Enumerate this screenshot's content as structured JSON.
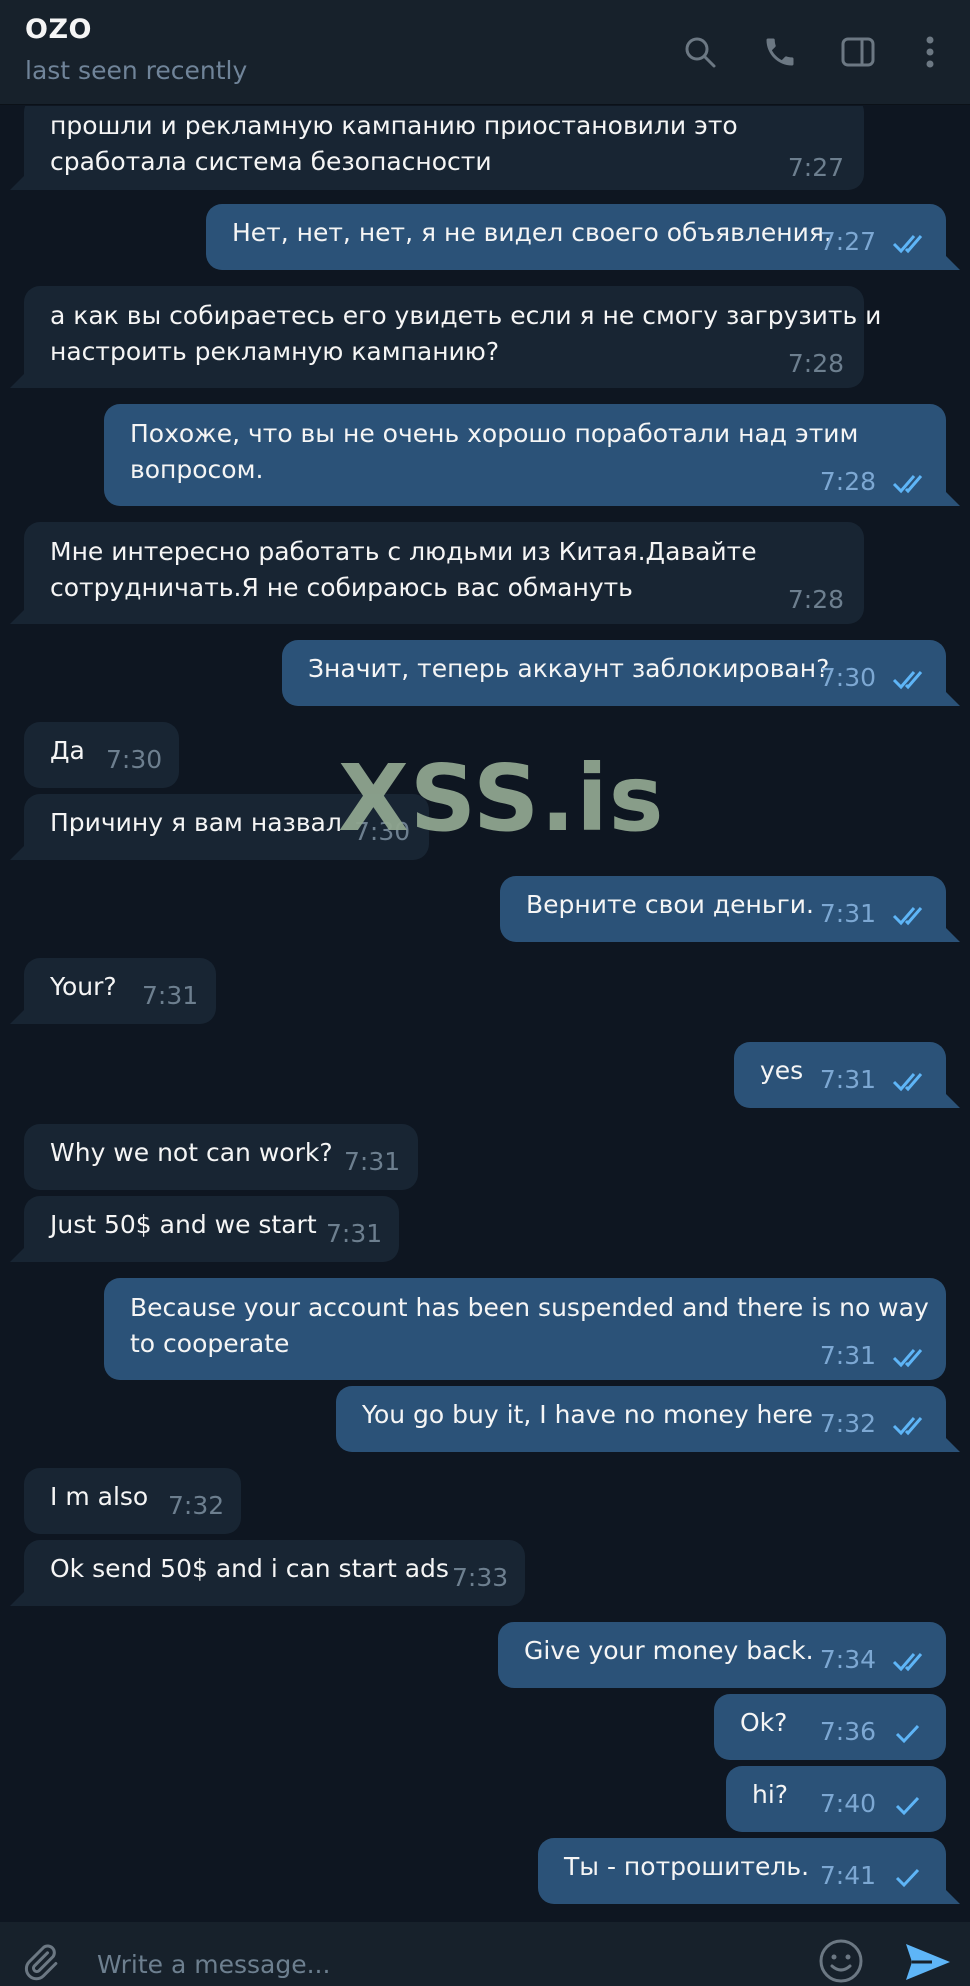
{
  "header": {
    "name": "OZO",
    "status": "last seen recently",
    "icons": [
      "search-icon",
      "phone-icon",
      "sidebar-toggle-icon",
      "more-vert-icon"
    ]
  },
  "watermark": "XSS.is",
  "messages": [
    {
      "dir": "in",
      "lines": [
        "прошли и рекламную кампанию приостановили это",
        "сработала система безопасности"
      ],
      "time": "7:27"
    },
    {
      "dir": "out",
      "lines": [
        "Нет, нет, нет, я не видел своего объявления."
      ],
      "time": "7:27",
      "status": "read"
    },
    {
      "dir": "in",
      "lines": [
        "а как вы собираетесь его увидеть если я не смогу загрузить и",
        "настроить рекламную кампанию?"
      ],
      "time": "7:28"
    },
    {
      "dir": "out",
      "lines": [
        "Похоже, что вы не очень хорошо поработали над этим",
        "вопросом."
      ],
      "time": "7:28",
      "status": "read"
    },
    {
      "dir": "in",
      "lines": [
        "Мне интересно работать с людьми из Китая.Давайте",
        "сотрудничать.Я не собираюсь вас обмануть"
      ],
      "time": "7:28"
    },
    {
      "dir": "out",
      "lines": [
        "Значит, теперь аккаунт заблокирован?"
      ],
      "time": "7:30",
      "status": "read"
    },
    {
      "dir": "in",
      "lines": [
        "Да"
      ],
      "time": "7:30"
    },
    {
      "dir": "in",
      "lines": [
        "Причину я вам назвал"
      ],
      "time": "7:30"
    },
    {
      "dir": "out",
      "lines": [
        "Верните свои деньги."
      ],
      "time": "7:31",
      "status": "read"
    },
    {
      "dir": "in",
      "lines": [
        "Your?"
      ],
      "time": "7:31"
    },
    {
      "dir": "out",
      "lines": [
        "yes"
      ],
      "time": "7:31",
      "status": "read"
    },
    {
      "dir": "in",
      "lines": [
        "Why we not can work?"
      ],
      "time": "7:31"
    },
    {
      "dir": "in",
      "lines": [
        "Just 50$ and we start"
      ],
      "time": "7:31"
    },
    {
      "dir": "out",
      "lines": [
        "Because your account has been suspended and there is no way",
        "to cooperate"
      ],
      "time": "7:31",
      "status": "read"
    },
    {
      "dir": "out",
      "lines": [
        "You go buy it, I have no money here"
      ],
      "time": "7:32",
      "status": "read"
    },
    {
      "dir": "in",
      "lines": [
        "I m also"
      ],
      "time": "7:32"
    },
    {
      "dir": "in",
      "lines": [
        "Ok send 50$ and i can start ads"
      ],
      "time": "7:33"
    },
    {
      "dir": "out",
      "lines": [
        "Give your money back."
      ],
      "time": "7:34",
      "status": "read"
    },
    {
      "dir": "out",
      "lines": [
        "Ok?"
      ],
      "time": "7:36",
      "status": "sent"
    },
    {
      "dir": "out",
      "lines": [
        "hi?"
      ],
      "time": "7:40",
      "status": "sent"
    },
    {
      "dir": "out",
      "lines": [
        "Ты - потрошитель."
      ],
      "time": "7:41",
      "status": "sent"
    }
  ],
  "composer": {
    "placeholder": "Write a message..."
  },
  "colors": {
    "background": "#0e1621",
    "header": "#17212b",
    "incoming_bubble": "#182533",
    "outgoing_bubble": "#2b5278",
    "accent": "#5eb5f7"
  }
}
